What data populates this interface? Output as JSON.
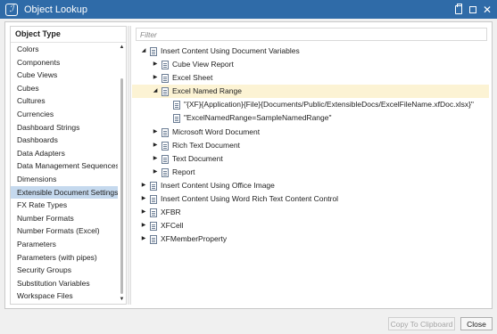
{
  "window": {
    "title": "Object Lookup"
  },
  "object_type": {
    "header": "Object Type",
    "items": [
      "Colors",
      "Components",
      "Cube Views",
      "Cubes",
      "Cultures",
      "Currencies",
      "Dashboard Strings",
      "Dashboards",
      "Data Adapters",
      "Data Management Sequences",
      "Dimensions",
      "Extensible Document Settings",
      "FX Rate Types",
      "Number Formats",
      "Number Formats (Excel)",
      "Parameters",
      "Parameters (with pipes)",
      "Security Groups",
      "Substitution Variables",
      "Workspace Files"
    ],
    "selected": "Extensible Document Settings"
  },
  "filter": {
    "placeholder": "Filter",
    "value": ""
  },
  "tree": [
    {
      "label": "Insert Content Using Document Variables",
      "level": 0,
      "expanded": true
    },
    {
      "label": "Cube View Report",
      "level": 1,
      "expanded": false
    },
    {
      "label": "Excel Sheet",
      "level": 1,
      "expanded": false
    },
    {
      "label": "Excel Named Range",
      "level": 1,
      "expanded": true,
      "highlighted": true
    },
    {
      "label": "\"{XF}{Application}{File}{Documents/Public/ExtensibleDocs/ExcelFileName.xfDoc.xlsx}\"",
      "level": 2,
      "leaf": true
    },
    {
      "label": "\"ExcelNamedRange=SampleNamedRange\"",
      "level": 2,
      "leaf": true
    },
    {
      "label": "Microsoft Word Document",
      "level": 1,
      "expanded": false
    },
    {
      "label": "Rich Text Document",
      "level": 1,
      "expanded": false
    },
    {
      "label": "Text Document",
      "level": 1,
      "expanded": false
    },
    {
      "label": "Report",
      "level": 1,
      "expanded": false
    },
    {
      "label": "Insert Content Using Office Image",
      "level": 0,
      "expanded": false
    },
    {
      "label": "Insert Content Using Word Rich Text Content Control",
      "level": 0,
      "expanded": false
    },
    {
      "label": "XFBR",
      "level": 0,
      "expanded": false
    },
    {
      "label": "XFCell",
      "level": 0,
      "expanded": false
    },
    {
      "label": "XFMemberProperty",
      "level": 0,
      "expanded": false
    }
  ],
  "buttons": {
    "copy": "Copy To Clipboard",
    "close": "Close"
  },
  "colors": {
    "titlebar": "#2f6ba8",
    "selection": "#c5d9ee",
    "highlight": "#fcf3d4"
  }
}
